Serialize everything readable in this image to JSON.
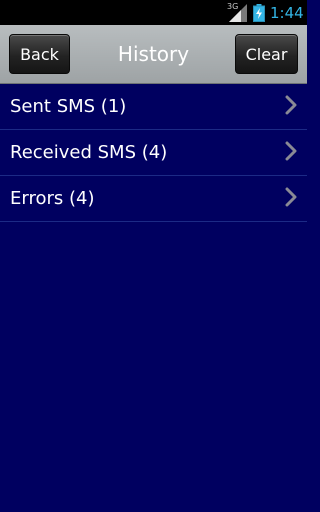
{
  "status_bar": {
    "network": "3G",
    "time": "1:44",
    "icons": [
      "signal-icon",
      "battery-icon"
    ]
  },
  "header": {
    "back_label": "Back",
    "title": "History",
    "clear_label": "Clear"
  },
  "list": {
    "items": [
      {
        "label": "Sent SMS (1)",
        "icon": "chevron-right-icon"
      },
      {
        "label": "Received SMS (4)",
        "icon": "chevron-right-icon"
      },
      {
        "label": "Errors (4)",
        "icon": "chevron-right-icon"
      }
    ]
  },
  "colors": {
    "background": "#000060",
    "header": "#a9aeb0",
    "time": "#33b5e5"
  }
}
